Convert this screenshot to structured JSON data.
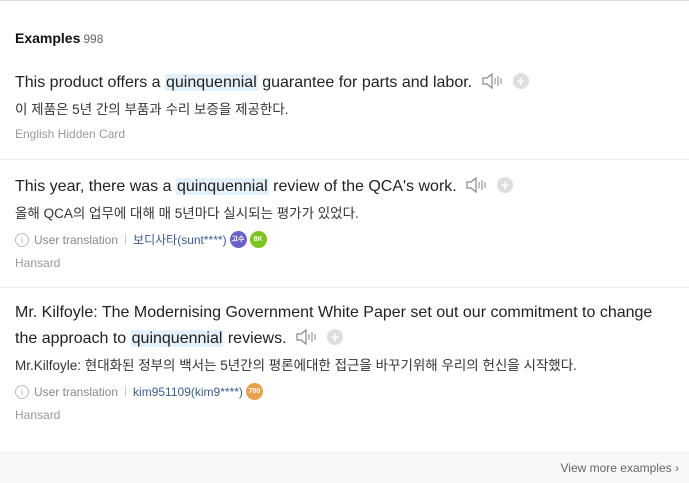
{
  "header": {
    "title": "Examples",
    "count": "998"
  },
  "examples": [
    {
      "en_before": "This product offers a ",
      "en_highlight": "quinquennial",
      "en_after": " guarantee for parts and labor.",
      "ko": "이 제품은 5년 간의 부품과 수리 보증을 제공한다.",
      "source": "English Hidden Card"
    },
    {
      "en_before": "This year, there was a ",
      "en_highlight": "quinquennial",
      "en_after": " review of the QCA's work.",
      "ko": "올해 QCA의 업무에 대해 매 5년마다 실시되는 평가가 있었다.",
      "meta_label": "User translation",
      "user": "보디사타(sunt****)",
      "badges": [
        {
          "text": "고수 15",
          "color": "#6b62c9"
        },
        {
          "text": "8K",
          "color": "#7cc51f"
        }
      ],
      "source": "Hansard"
    },
    {
      "en_before": "Mr. Kilfoyle: The Modernising Government White Paper set out our commitment to change the approach to ",
      "en_highlight": "quinquennial",
      "en_after": " reviews.",
      "ko": "Mr.Kilfoyle: 현대화된 정부의 백서는 5년간의 평론에대한 접근을 바꾸기위해 우리의 헌신을 시작했다.",
      "meta_label": "User translation",
      "user": "kim951109(kim9****)",
      "badges": [
        {
          "text": "700",
          "color": "#e8a14a"
        }
      ],
      "source": "Hansard"
    }
  ],
  "footer": {
    "view_more": "View more examples"
  },
  "icons": {
    "speaker": "speaker-icon",
    "add": "plus-icon",
    "info": "info-icon",
    "chevron": "chevron-right-icon"
  },
  "colors": {
    "highlight": "#e4f1fb",
    "user_link": "#3b5b8f"
  }
}
